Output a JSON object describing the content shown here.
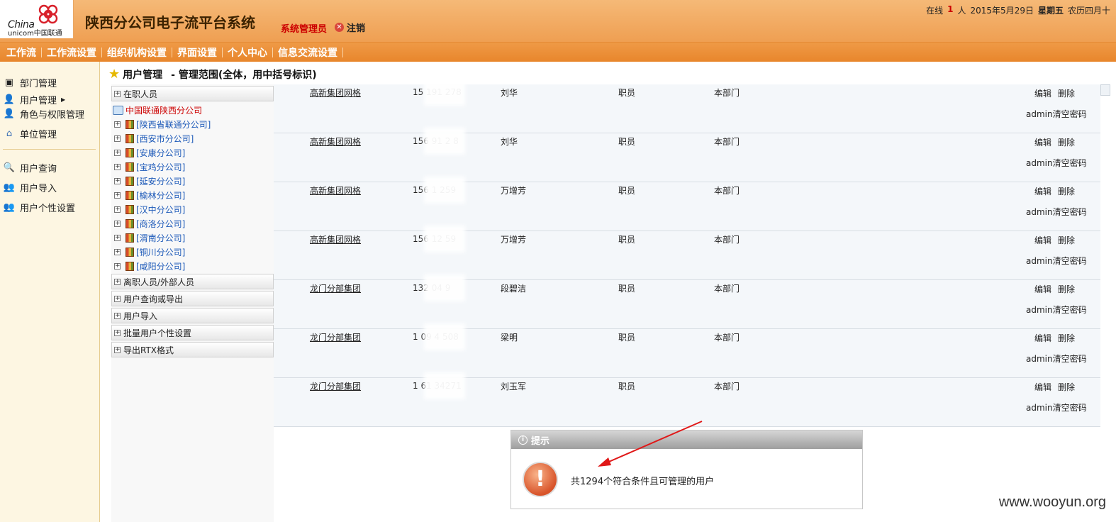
{
  "header": {
    "logo_china": "China",
    "logo_unicom": "unicom中国联通",
    "system_title": "陕西分公司电子流平台系统",
    "admin_label": "系统管理员",
    "logout_label": "注销",
    "online_label": "在线",
    "online_count": "1",
    "online_unit": "人",
    "date": "2015年5月29日",
    "weekday": "星期五",
    "lunar": "农历四月十"
  },
  "menu": [
    "工作流",
    "工作流设置",
    "组织机构设置",
    "界面设置",
    "个人中心",
    "信息交流设置"
  ],
  "sidebar": {
    "items": [
      {
        "label": "部门管理",
        "icon": "department-icon"
      },
      {
        "label": "用户管理",
        "icon": "user-icon"
      },
      {
        "label": "角色与权限管理",
        "icon": "role-icon"
      },
      {
        "label": "单位管理",
        "icon": "home-icon"
      },
      {
        "label": "用户查询",
        "icon": "search-icon"
      },
      {
        "label": "用户导入",
        "icon": "user-import-icon"
      },
      {
        "label": "用户个性设置",
        "icon": "user-settings-icon"
      }
    ]
  },
  "page_title": {
    "title": "用户管理",
    "range": "- 管理范围(全体，用中括号标识)"
  },
  "tree": {
    "active_panel": "在职人员",
    "root": "中国联通陕西分公司",
    "nodes": [
      "[陕西省联通分公司]",
      "[西安市分公司]",
      "[安康分公司]",
      "[宝鸡分公司]",
      "[延安分公司]",
      "[榆林分公司]",
      "[汉中分公司]",
      "[商洛分公司]",
      "[渭南分公司]",
      "[铜川分公司]",
      "[咸阳分公司]"
    ],
    "panels": [
      "离职人员/外部人员",
      "用户查询或导出",
      "用户导入",
      "批量用户个性设置",
      "导出RTX格式"
    ]
  },
  "table": {
    "edit_label": "编辑",
    "delete_label": "删除",
    "reset_label": "admin清空密码",
    "rows": [
      {
        "unit": "高新集团网格",
        "phone": "15 191 278",
        "name": "刘华",
        "role": "职员",
        "dept": "本部门"
      },
      {
        "unit": "高新集团网格",
        "phone": "156 91 2 8",
        "name": "刘华",
        "role": "职员",
        "dept": "本部门"
      },
      {
        "unit": "高新集团网格",
        "phone": "156 1 259",
        "name": "万增芳",
        "role": "职员",
        "dept": "本部门"
      },
      {
        "unit": "高新集团网格",
        "phone": "156 12 59",
        "name": "万增芳",
        "role": "职员",
        "dept": "本部门"
      },
      {
        "unit": "龙门分部集团",
        "phone": "132 04 9",
        "name": "段碧洁",
        "role": "职员",
        "dept": "本部门"
      },
      {
        "unit": "龙门分部集团",
        "phone": "1 09 4 508",
        "name": "梁明",
        "role": "职员",
        "dept": "本部门"
      },
      {
        "unit": "龙门分部集团",
        "phone": "1 61 34271",
        "name": "刘玉军",
        "role": "职员",
        "dept": "本部门"
      }
    ]
  },
  "dialog": {
    "title": "提示",
    "message": "共1294个符合条件且可管理的用户"
  },
  "watermark": "www.wooyun.org",
  "colors": {
    "header_orange": "#ef9f52",
    "menu_orange": "#e8862c",
    "admin_red": "#cc0000",
    "link_blue": "#1b58b8"
  }
}
